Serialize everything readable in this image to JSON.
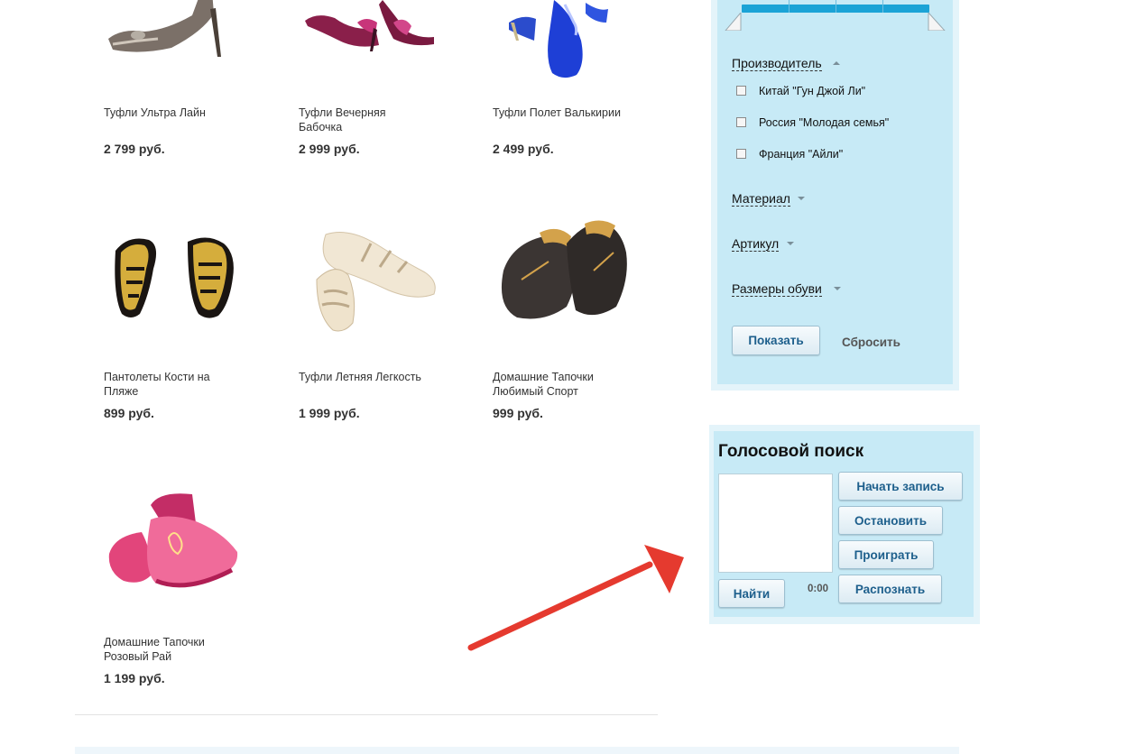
{
  "products": [
    {
      "name": "Туфли Ультра Лайн",
      "price": "2 799 руб."
    },
    {
      "name": "Туфли Вечерняя Бабочка",
      "price": "2 999 руб."
    },
    {
      "name": "Туфли Полет Валькирии",
      "price": "2 499 руб."
    },
    {
      "name": "Пантолеты Кости на Пляже",
      "price": "899 руб."
    },
    {
      "name": "Туфли Летняя Легкость",
      "price": "1 999 руб."
    },
    {
      "name": "Домашние Тапочки Любимый Спорт",
      "price": "999 руб."
    },
    {
      "name": "Домашние Тапочки Розовый Рай",
      "price": "1 199 руб."
    }
  ],
  "filter": {
    "manufacturer_title": "Производитель",
    "manufacturers": [
      {
        "label": "Китай \"Гун Джой Ли\"",
        "checked": false
      },
      {
        "label": "Россия \"Молодая семья\"",
        "checked": false
      },
      {
        "label": "Франция \"Айли\"",
        "checked": false
      }
    ],
    "material_title": "Материал",
    "article_title": "Артикул",
    "sizes_title": "Размеры обуви",
    "show_label": "Показать",
    "reset_label": "Сбросить"
  },
  "voice_search": {
    "title": "Голосовой поиск",
    "start_label": "Начать запись",
    "stop_label": "Остановить",
    "play_label": "Проиграть",
    "recognize_label": "Распознать",
    "find_label": "Найти",
    "timer": "0:00"
  },
  "colors": {
    "panel_bg": "#c7eaf6",
    "panel_border": "#e4f4fa",
    "button_text": "#1d5f8c",
    "annotation_arrow": "#e53a2f",
    "slider_fill": "#1ba3d6"
  }
}
